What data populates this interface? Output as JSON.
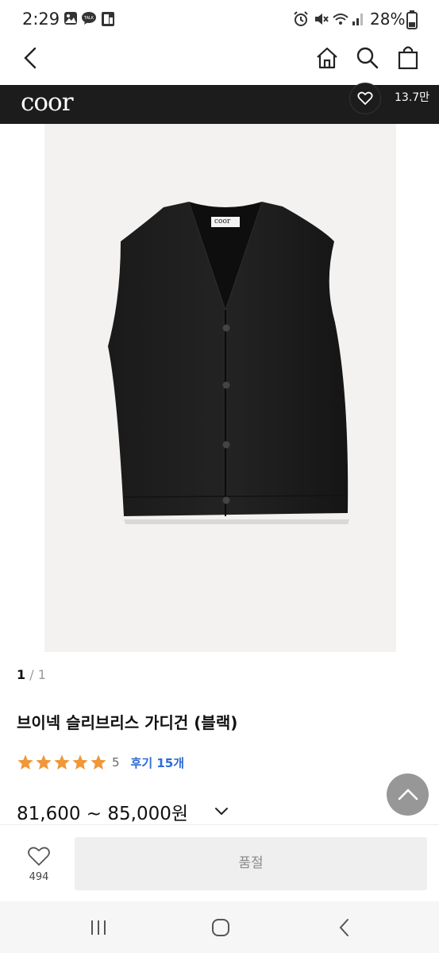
{
  "status_bar": {
    "time": "2:29",
    "battery": "28%"
  },
  "nav": {
    "icons": [
      "back-icon",
      "home-icon",
      "search-icon",
      "shopping-bag-icon"
    ]
  },
  "brand": {
    "logo": "coor",
    "like_count": "13.7만"
  },
  "pager": {
    "current": "1",
    "total": " / 1"
  },
  "product": {
    "title": "브이넥 슬리브리스 가디건 (블랙)",
    "rating": {
      "stars": 5,
      "score": "5",
      "reviews": "후기 15개"
    },
    "price": "81,600 ~ 85,000원"
  },
  "purchase_bar": {
    "wish_count": "494",
    "soldout_label": "품절"
  },
  "colors": {
    "brand_bar": "#1c1c1c",
    "star": "#f0973a",
    "review_link": "#2d6bd6"
  }
}
